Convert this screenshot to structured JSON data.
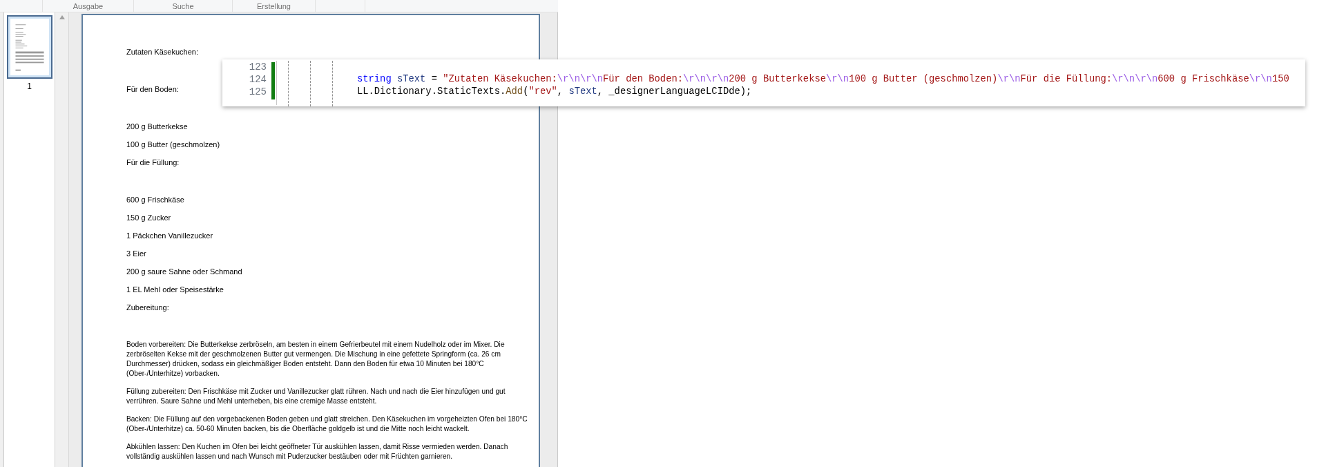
{
  "ribbon": {
    "groups": [
      "Ausgabe",
      "Suche",
      "Erstellung"
    ]
  },
  "thumbnails": [
    {
      "label": "1",
      "selected": true
    }
  ],
  "document": {
    "lines": [
      {
        "kind": "heading",
        "text": "Zutaten Käsekuchen:"
      },
      {
        "kind": "heading",
        "text": "Für den Boden:"
      },
      {
        "kind": "item",
        "text": "200 g Butterkekse"
      },
      {
        "kind": "item",
        "text": "100 g Butter (geschmolzen)"
      },
      {
        "kind": "heading",
        "text": "Für die Füllung:"
      },
      {
        "kind": "item",
        "text": "600 g Frischkäse"
      },
      {
        "kind": "item",
        "text": "150 g Zucker"
      },
      {
        "kind": "item",
        "text": "1 Päckchen Vanillezucker"
      },
      {
        "kind": "item",
        "text": "3 Eier"
      },
      {
        "kind": "item",
        "text": "200 g saure Sahne oder Schmand"
      },
      {
        "kind": "item",
        "text": "1 EL Mehl oder Speisestärke"
      },
      {
        "kind": "heading",
        "text": "Zubereitung:"
      }
    ],
    "paragraphs": [
      "Boden vorbereiten: Die Butterkekse zerbröseln, am besten in einem Gefrierbeutel mit einem Nudelholz oder im Mixer. Die zerbröselten Kekse mit der geschmolzenen Butter gut vermengen. Die Mischung in eine gefettete Springform (ca. 26 cm Durchmesser) drücken, sodass ein gleichmäßiger Boden entsteht. Dann den Boden für etwa 10 Minuten bei 180°C (Ober-/Unterhitze) vorbacken.",
      "Füllung zubereiten: Den Frischkäse mit Zucker und Vanillezucker glatt rühren. Nach und nach die Eier hinzufügen und gut verrühren. Saure Sahne und Mehl unterheben, bis eine cremige Masse entsteht.",
      "Backen: Die Füllung auf den vorgebackenen Boden geben und glatt streichen. Den Käsekuchen im vorgeheizten Ofen bei 180°C (Ober-/Unterhitze) ca. 50-60 Minuten backen, bis die Oberfläche goldgelb ist und die Mitte noch leicht wackelt.",
      "Abkühlen lassen: Den Kuchen im Ofen bei leicht geöffneter Tür auskühlen lassen, damit Risse vermieden werden. Danach vollständig auskühlen lassen und nach Wunsch mit Puderzucker bestäuben oder mit Früchten garnieren."
    ]
  },
  "code_snippet": {
    "lines": [
      {
        "number": "123"
      },
      {
        "number": "124",
        "tokens": [
          {
            "kind": "keyword",
            "text": "string "
          },
          {
            "kind": "variable",
            "text": "sText"
          },
          {
            "kind": "plain",
            "text": " = "
          },
          {
            "kind": "string",
            "text": "\"Zutaten Käsekuchen:"
          },
          {
            "kind": "escape",
            "text": "\\r\\n\\r\\n"
          },
          {
            "kind": "string",
            "text": "Für den Boden:"
          },
          {
            "kind": "escape",
            "text": "\\r\\n\\r\\n"
          },
          {
            "kind": "string",
            "text": "200 g Butterkekse"
          },
          {
            "kind": "escape",
            "text": "\\r\\n"
          },
          {
            "kind": "string",
            "text": "100 g Butter (geschmolzen)"
          },
          {
            "kind": "escape",
            "text": "\\r\\n"
          },
          {
            "kind": "string",
            "text": "Für die Füllung:"
          },
          {
            "kind": "escape",
            "text": "\\r\\n\\r\\n"
          },
          {
            "kind": "string",
            "text": "600 g Frischkäse"
          },
          {
            "kind": "escape",
            "text": "\\r\\n"
          },
          {
            "kind": "string",
            "text": "150"
          }
        ]
      },
      {
        "number": "125",
        "tokens": [
          {
            "kind": "plain",
            "text": "LL.Dictionary.StaticTexts."
          },
          {
            "kind": "method",
            "text": "Add"
          },
          {
            "kind": "plain",
            "text": "("
          },
          {
            "kind": "string",
            "text": "\"rev\""
          },
          {
            "kind": "plain",
            "text": ", "
          },
          {
            "kind": "variable",
            "text": "sText"
          },
          {
            "kind": "plain",
            "text": ", _designerLanguageLCIDde);"
          }
        ]
      }
    ]
  }
}
